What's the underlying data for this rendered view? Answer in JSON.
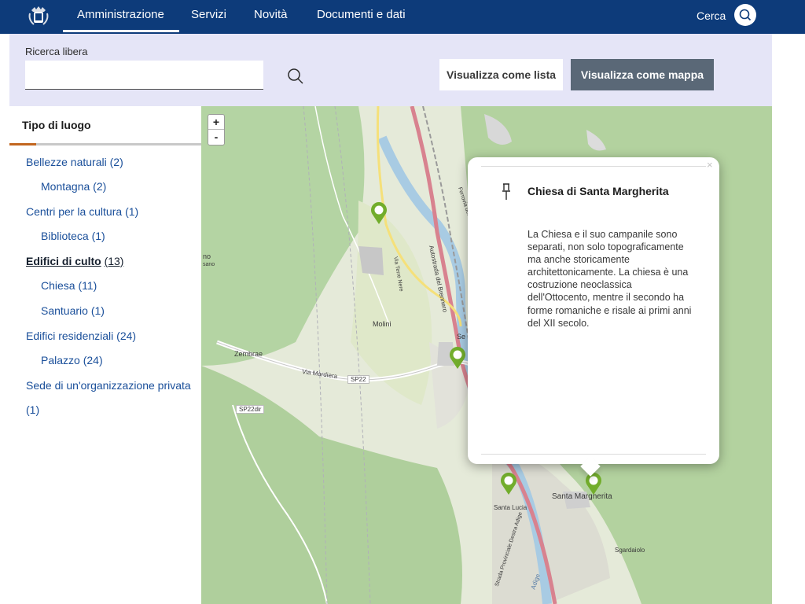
{
  "header": {
    "nav": [
      {
        "label": "Amministrazione",
        "active": true
      },
      {
        "label": "Servizi",
        "active": false
      },
      {
        "label": "Novità",
        "active": false
      },
      {
        "label": "Documenti e dati",
        "active": false
      }
    ],
    "search_label": "Cerca"
  },
  "search": {
    "label": "Ricerca libera",
    "value": "",
    "view_list_label": "Visualizza come lista",
    "view_map_label": "Visualizza come mappa"
  },
  "filters": {
    "title": "Tipo di luogo",
    "items": [
      {
        "label": "Bellezze naturali",
        "count": "(2)",
        "level": 0
      },
      {
        "label": "Montagna",
        "count": "(2)",
        "level": 1
      },
      {
        "label": "Centri per la cultura",
        "count": "(1)",
        "level": 0
      },
      {
        "label": "Biblioteca",
        "count": "(1)",
        "level": 1
      },
      {
        "label": "Edifici di culto",
        "count": "(13)",
        "level": 0,
        "active": true
      },
      {
        "label": "Chiesa",
        "count": "(11)",
        "level": 1
      },
      {
        "label": "Santuario",
        "count": "(1)",
        "level": 1
      },
      {
        "label": "Edifici residenziali",
        "count": "(24)",
        "level": 0
      },
      {
        "label": "Palazzo",
        "count": "(24)",
        "level": 1
      },
      {
        "label": "Sede di un'organizzazione privata",
        "count": "(1)",
        "level": 0
      }
    ]
  },
  "map": {
    "zoom_in": "+",
    "zoom_out": "-",
    "labels": [
      "Molini",
      "Zembrae",
      "Via Mardiera",
      "SP22",
      "SP22dir",
      "Santa Margherita",
      "Santa Lucia",
      "Sgardaiolo",
      "Via Terre Nere",
      "Autostrada del Brennero",
      "Strada Provinciale Destra Adige",
      "Adige",
      "Ferrovia del Brennero",
      "Se",
      "no",
      "sano"
    ],
    "popup": {
      "title": "Chiesa di Santa Margherita",
      "body": "La Chiesa e il suo campanile sono separati, non solo topograficamente ma anche storicamente architettonicamente. La chiesa è una costruzione neoclassica dell'Ottocento, mentre il secondo ha forme romaniche e risale ai primi anni del XII secolo.",
      "close": "×"
    },
    "colors": {
      "marker": "#72ad2c",
      "land": "#e5ead9",
      "forest": "#a9cc95",
      "river": "#a8cbe3",
      "motorway": "#d8828f"
    }
  }
}
